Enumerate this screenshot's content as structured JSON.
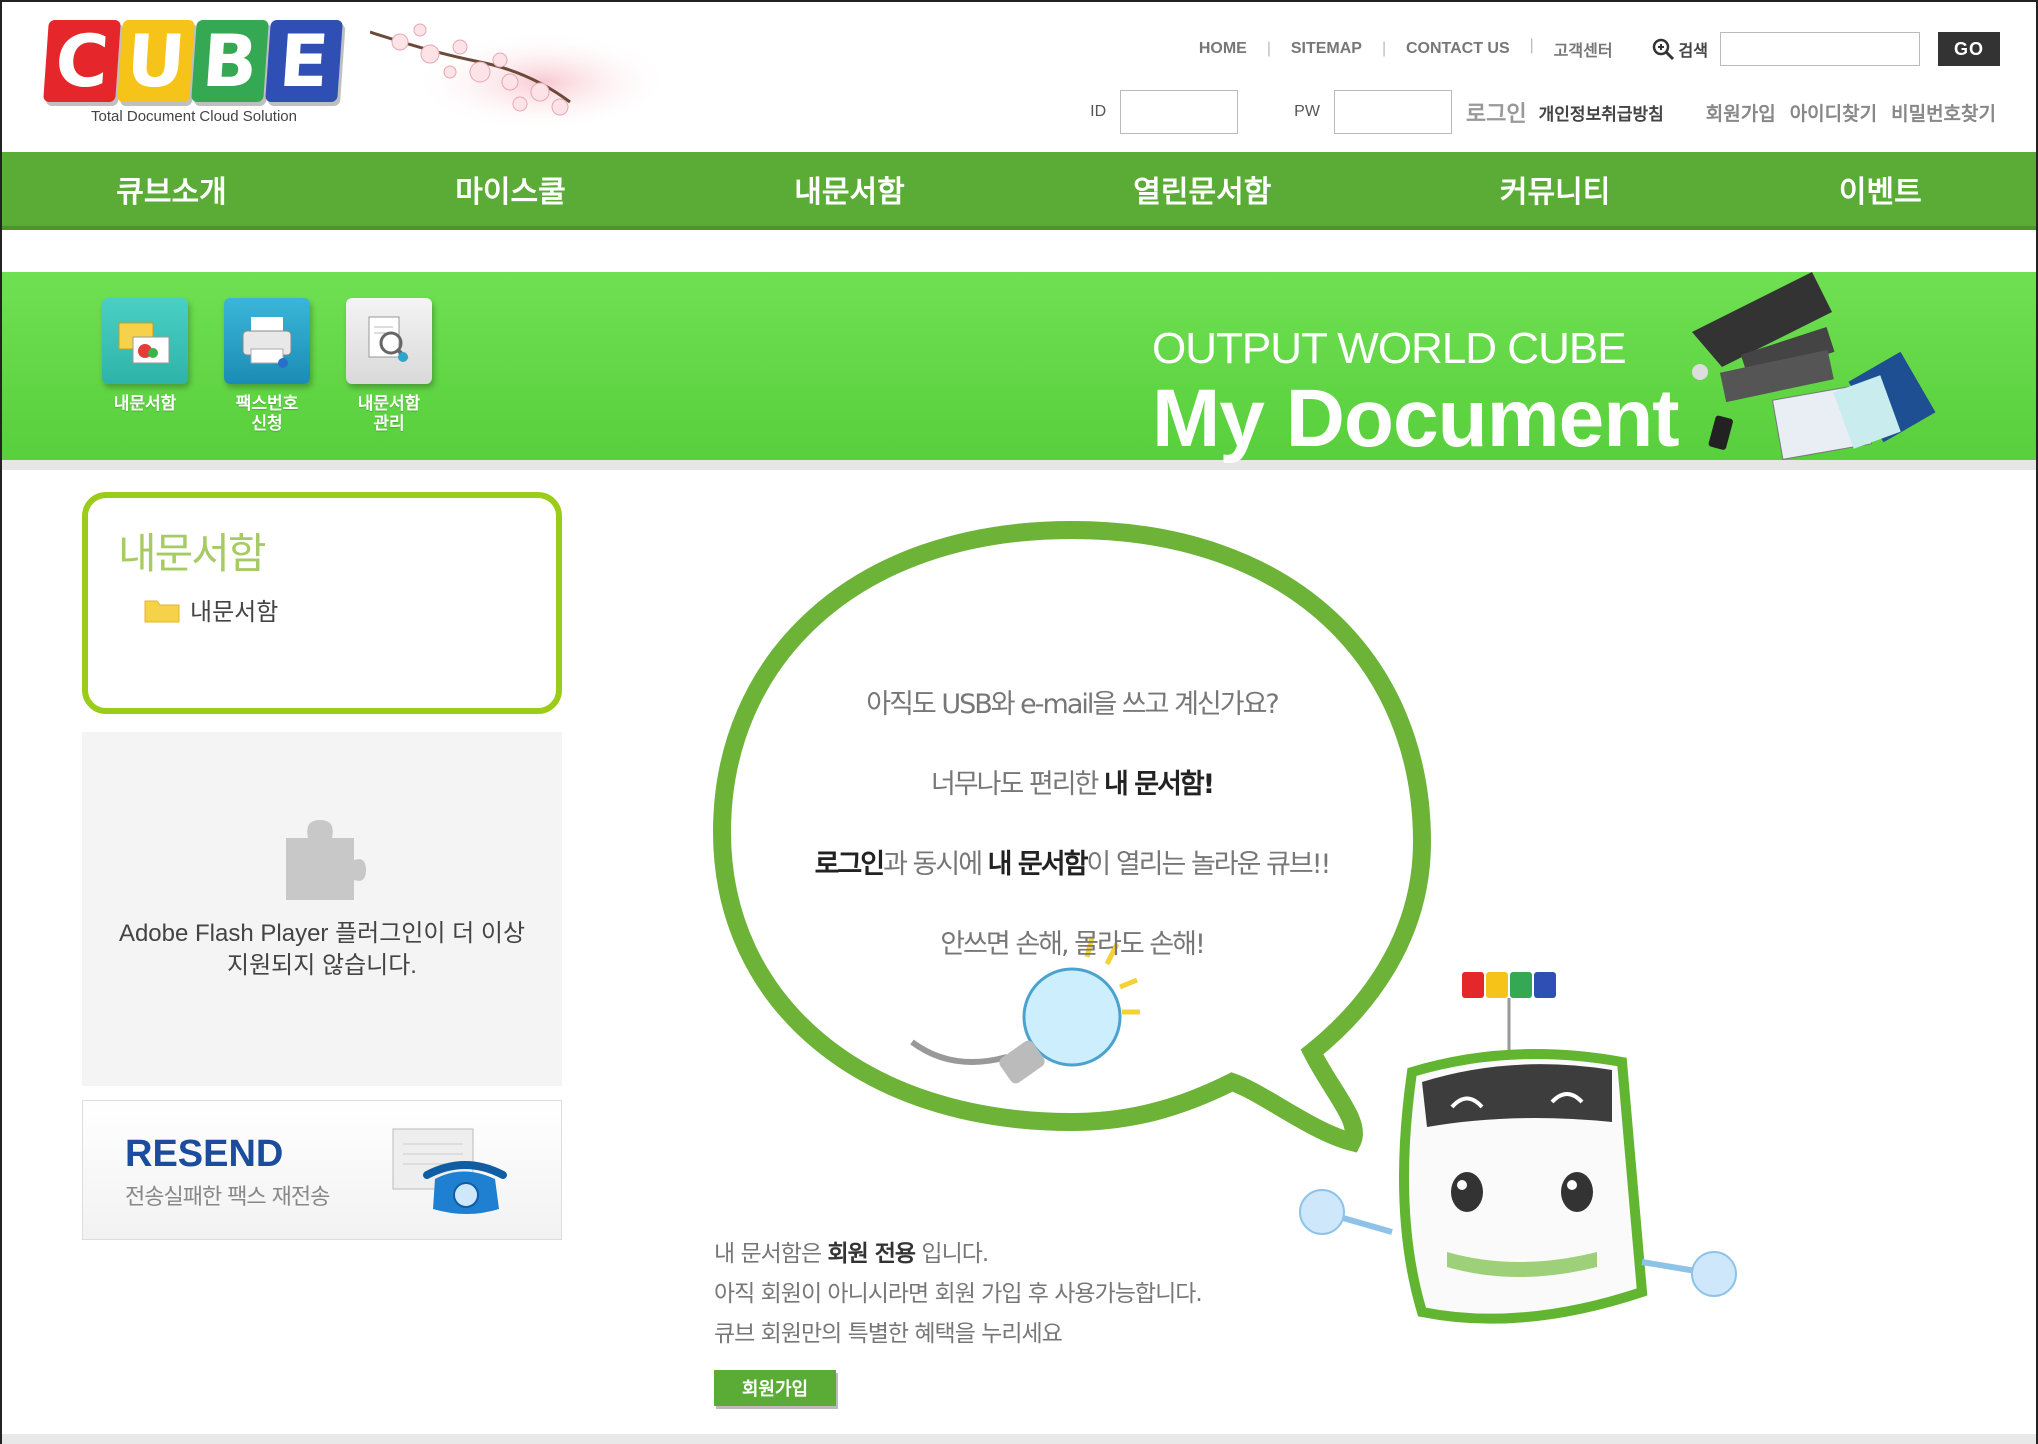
{
  "header": {
    "logo_letters": [
      "C",
      "U",
      "B",
      "E"
    ],
    "logo_colors": [
      "#e5262a",
      "#f6c418",
      "#34a853",
      "#2f4fb5"
    ],
    "logo_tagline": "Total Document Cloud Solution",
    "top_links": [
      "HOME",
      "SITEMAP",
      "CONTACT US",
      "고객센터"
    ],
    "search_label": "검색",
    "search_button": "GO",
    "id_label": "ID",
    "pw_label": "PW",
    "login_label": "로그인",
    "privacy_label": "개인정보취급방침",
    "util_links": [
      "회원가입",
      "아이디찾기",
      "비밀번호찾기"
    ]
  },
  "main_nav": [
    "큐브소개",
    "마이스쿨",
    "내문서함",
    "열린문서함",
    "커뮤니티",
    "이벤트"
  ],
  "banner": {
    "quick_items": [
      {
        "label": "내문서함",
        "icon": "folder-icon"
      },
      {
        "label": "팩스번호\n신청",
        "icon": "fax-printer-icon"
      },
      {
        "label": "내문서함\n관리",
        "icon": "document-search-icon"
      }
    ],
    "subtitle": "OUTPUT WORLD CUBE",
    "title": "My Document"
  },
  "sidebar": {
    "title": "내문서함",
    "item": "내문서함",
    "flash_message": "Adobe Flash Player 플러그인이 더 이상\n지원되지 않습니다.",
    "resend_title": "RESEND",
    "resend_sub": "전송실패한 팩스 재전송"
  },
  "bubble": {
    "line1": "아직도 USB와 e-mail을 쓰고 계신가요?",
    "line2_pre": "너무나도 편리한 ",
    "line2_bold": "내 문서함!",
    "line3_bold1": "로그인",
    "line3_mid": "과 동시에 ",
    "line3_bold2": "내 문서함",
    "line3_post": "이 열리는 놀라운 큐브!!",
    "line4": "안쓰면 손해, 몰라도 손해!"
  },
  "member": {
    "line1_pre": "내 문서함은 ",
    "line1_bold": "회원 전용",
    "line1_post": " 입니다.",
    "line2": "아직 회원이 아니시라면 회원 가입 후 사용가능합니다.",
    "line3": "큐브 회원만의 특별한 혜택을 누리세요",
    "join_button": "회원가입"
  },
  "colors": {
    "nav_green": "#5aac36",
    "banner_green": "#62d846",
    "sidebox_border": "#9ccc1a",
    "resend_blue": "#1b4d9c"
  }
}
